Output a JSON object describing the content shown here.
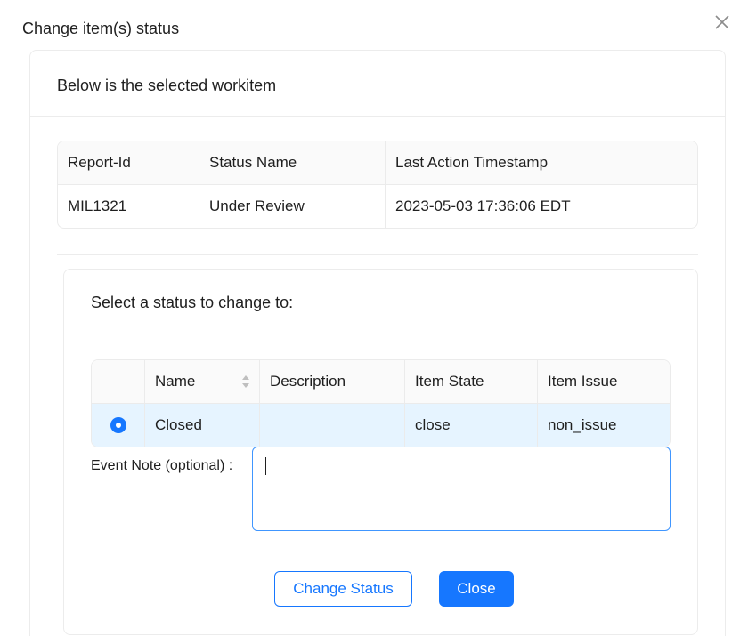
{
  "modal": {
    "title": "Change item(s) status",
    "close_icon": "close-icon"
  },
  "selected_section": {
    "heading": "Below is the selected workitem",
    "columns": [
      "Report-Id",
      "Status Name",
      "Last Action Timestamp"
    ],
    "rows": [
      [
        "MIL1321",
        "Under Review",
        "2023-05-03 17:36:06 EDT"
      ]
    ]
  },
  "status_section": {
    "heading": "Select a status to change to:",
    "columns": [
      "",
      "Name",
      "Description",
      "Item State",
      "Item Issue"
    ],
    "rows": [
      {
        "selected": true,
        "name": "Closed",
        "description": "",
        "item_state": "close",
        "item_issue": "non_issue"
      }
    ],
    "note_label": "Event Note (optional)",
    "note_value": "",
    "change_button": "Change Status",
    "close_button": "Close"
  },
  "colors": {
    "primary": "#1677ff",
    "selected_row": "#e6f4ff",
    "border": "#ebebeb"
  }
}
